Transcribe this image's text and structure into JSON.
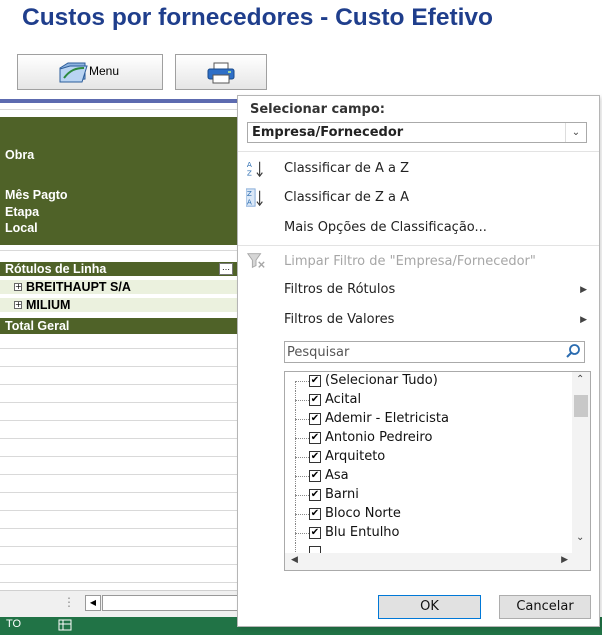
{
  "title": "Custos por fornecedores - Custo Efetivo",
  "toolbar": {
    "menu_label": "Menu"
  },
  "pivot": {
    "fields": [
      "Obra",
      "Mês Pagto",
      "Etapa",
      "Local"
    ],
    "row_labels_header": "Rótulos de Linha",
    "rows": [
      "BREITHAUPT S/A",
      "MILIUM"
    ],
    "total_label": "Total Geral"
  },
  "status": {
    "left_text": "TO"
  },
  "popup": {
    "select_field_label": "Selecionar campo:",
    "select_field_value": "Empresa/Fornecedor",
    "menu": {
      "sort_az": "Classificar de A a Z",
      "sort_za": "Classificar de Z a A",
      "more_sort": "Mais Opções de Classificação...",
      "clear_filter": "Limpar Filtro de \"Empresa/Fornecedor\"",
      "label_filters": "Filtros de Rótulos",
      "value_filters": "Filtros de Valores"
    },
    "search_placeholder": "Pesquisar",
    "items": [
      {
        "label": "(Selecionar Tudo)",
        "checked": true
      },
      {
        "label": "Acital",
        "checked": true
      },
      {
        "label": "Ademir - Eletricista",
        "checked": true
      },
      {
        "label": "Antonio Pedreiro",
        "checked": true
      },
      {
        "label": "Arquiteto",
        "checked": true
      },
      {
        "label": "Asa",
        "checked": true
      },
      {
        "label": "Barni",
        "checked": true
      },
      {
        "label": "Bloco Norte",
        "checked": true
      },
      {
        "label": "Blu Entulho",
        "checked": true
      }
    ],
    "ok_label": "OK",
    "cancel_label": "Cancelar"
  },
  "colors": {
    "title": "#1f3e8c",
    "pivot_header": "#4f6228",
    "row_fill": "#ebf1de",
    "status_bar": "#217346"
  }
}
